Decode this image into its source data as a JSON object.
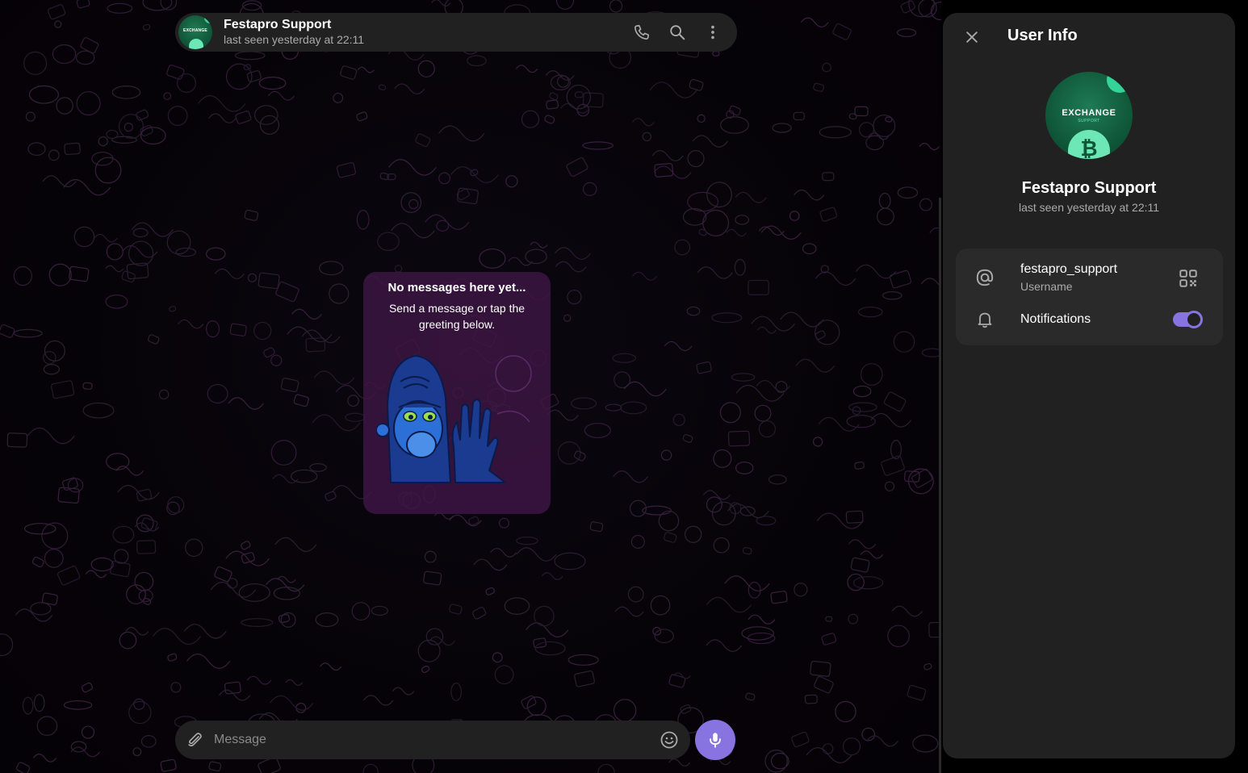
{
  "chat": {
    "title": "Festapro Support",
    "status": "last seen yesterday at 22:11",
    "avatar_text": "EXCHANGE"
  },
  "header_icons": [
    "phone-icon",
    "search-icon",
    "more-vertical-icon"
  ],
  "empty_state": {
    "title": "No messages here yet...",
    "subtitle": "Send a message or tap the greeting below."
  },
  "composer": {
    "placeholder": "Message"
  },
  "info_panel": {
    "title": "User Info",
    "avatar_text": "EXCHANGE",
    "avatar_subtext": "SUPPORT",
    "name": "Festapro Support",
    "status": "last seen yesterday at 22:11",
    "username": "festapro_support",
    "username_label": "Username",
    "notifications_label": "Notifications",
    "notifications_enabled": true
  },
  "colors": {
    "accent": "#8774e1",
    "panel": "#212121",
    "card": "#2a2a2a",
    "sticker_bg": "#3e1646"
  }
}
